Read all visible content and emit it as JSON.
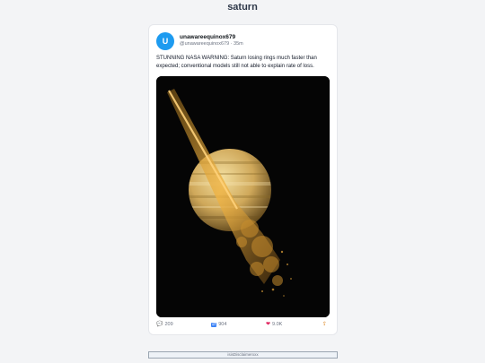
{
  "page": {
    "title": "saturn"
  },
  "post": {
    "avatar_letter": "U",
    "display_name": "unawareequinox679",
    "handle": "@unawareequinox679",
    "separator": " · ",
    "time": "35m",
    "text": "STUNNING NASA WARNING: Saturn losing rings much faster than expected; conventional models still not able to explain rate of loss.",
    "image_alt": "Saturn with rings breaking apart into a dust stream"
  },
  "actions": {
    "reply": {
      "icon": "speech-bubble-icon",
      "count": "209"
    },
    "repost": {
      "icon": "repost-icon",
      "count": "904"
    },
    "like": {
      "icon": "heart-icon",
      "count": "9.0K"
    },
    "share": {
      "icon": "share-icon"
    }
  },
  "footer": {
    "disclaimer": "isisDisclaimerxxx"
  },
  "colors": {
    "accent": "#1d9bf0",
    "like": "#e0245e",
    "planet": "#d8b766"
  }
}
